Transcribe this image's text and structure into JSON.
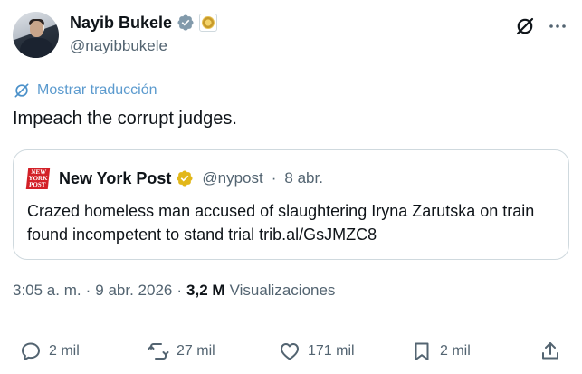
{
  "author": {
    "name": "Nayib Bukele",
    "handle": "@nayibbukele"
  },
  "translate_label": "Mostrar traducción",
  "tweet_text": "Impeach the corrupt judges.",
  "quoted": {
    "logo_lines": [
      "NEW",
      "YORK",
      "POST"
    ],
    "name": "New York Post",
    "handle": "@nypost",
    "separator": "·",
    "date": "8 abr.",
    "text": "Crazed homeless man accused of slaughtering Iryna Zarutska on train found incompetent to stand trial trib.al/GsJMZC8"
  },
  "meta": {
    "time": "3:05 a. m.",
    "sep1": "·",
    "date": "9 abr. 2026",
    "sep2": "·",
    "views_count": "3,2 M",
    "views_label": "Visualizaciones"
  },
  "actions": {
    "replies": "2 mil",
    "reposts": "27 mil",
    "likes": "171 mil",
    "bookmarks": "2 mil"
  },
  "colors": {
    "verified_blue": "#1d9bf0",
    "verified_gold": "#e2b719",
    "secondary_text": "#536471",
    "nypost_red": "#d32027"
  },
  "icons": [
    "verified-badge-icon",
    "government-badge-icon",
    "grok-icon",
    "more-icon",
    "translate-icon",
    "reply-icon",
    "repost-icon",
    "like-icon",
    "bookmark-icon",
    "share-icon"
  ]
}
